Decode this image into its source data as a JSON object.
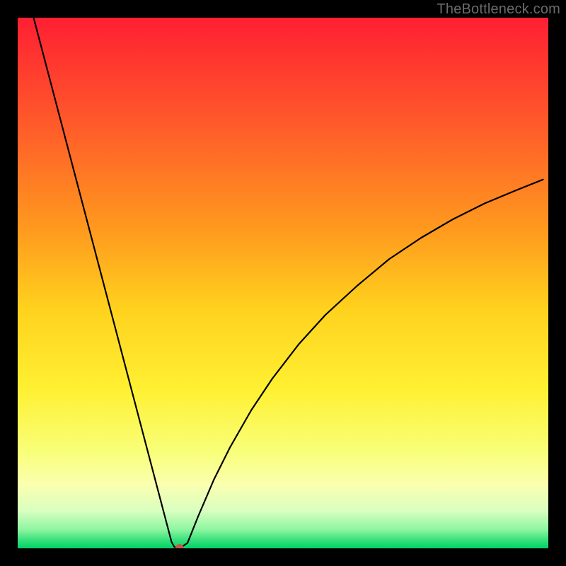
{
  "watermark": "TheBottleneck.com",
  "chart_data": {
    "type": "line",
    "title": "",
    "xlabel": "",
    "ylabel": "",
    "xlim": [
      0,
      100
    ],
    "ylim": [
      0,
      100
    ],
    "grid": false,
    "legend": false,
    "background_gradient": {
      "stops": [
        {
          "offset": 0.0,
          "color": "#ff1f33"
        },
        {
          "offset": 0.2,
          "color": "#ff5a2a"
        },
        {
          "offset": 0.4,
          "color": "#ff9a1e"
        },
        {
          "offset": 0.55,
          "color": "#ffd21e"
        },
        {
          "offset": 0.7,
          "color": "#fff032"
        },
        {
          "offset": 0.82,
          "color": "#f8ff7a"
        },
        {
          "offset": 0.88,
          "color": "#fbffb0"
        },
        {
          "offset": 0.93,
          "color": "#d8ffc0"
        },
        {
          "offset": 0.965,
          "color": "#8cf5a0"
        },
        {
          "offset": 0.985,
          "color": "#35e07a"
        },
        {
          "offset": 1.0,
          "color": "#00d267"
        }
      ]
    },
    "series": [
      {
        "name": "bottleneck-curve",
        "color": "#000000",
        "x": [
          3,
          5,
          7,
          9,
          11,
          13,
          15,
          17,
          19,
          21,
          23,
          25,
          27,
          29,
          29.5,
          30,
          30.5,
          32,
          34,
          37,
          40,
          44,
          48,
          53,
          58,
          64,
          70,
          76,
          82,
          88,
          94,
          99
        ],
        "y": [
          100,
          92.4,
          84.8,
          77.2,
          69.6,
          62.0,
          54.4,
          46.8,
          39.2,
          31.6,
          24.0,
          16.4,
          8.8,
          1.2,
          0.3,
          0.0,
          0.0,
          1.0,
          6.0,
          13.0,
          19.0,
          26.0,
          32.0,
          38.5,
          44.0,
          49.5,
          54.5,
          58.5,
          62.0,
          65.0,
          67.5,
          69.5
        ]
      }
    ],
    "marker": {
      "name": "optimal-point",
      "x": 30.5,
      "y": 0,
      "color": "#c15a4a",
      "radius_px": 6
    }
  }
}
